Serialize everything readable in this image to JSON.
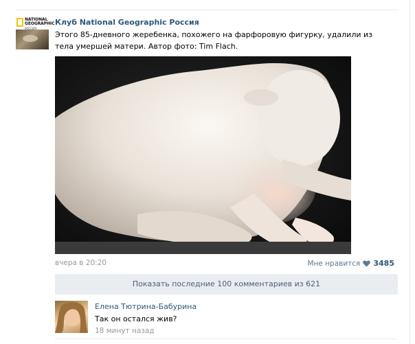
{
  "post": {
    "author": "Клуб National Geographic Россия",
    "text": "Этого 85-дневного жеребенка, похожего на фарфоровую фигурку, удалили из тела умершей матери. Автор фото: Tim Flach.",
    "avatar_logo": {
      "line1": "NATIONAL",
      "line2": "GEOGRAPHIC",
      "line3": "РОССИЯ"
    },
    "time": "вчера в 20:20",
    "like_label": "Мне нравится",
    "like_count": "3485",
    "accent_color": "#2b587a"
  },
  "comments_bar": {
    "label": "Показать последние 100 комментариев из 621"
  },
  "comments": [
    {
      "author": "Елена Тютрина-Бабурина",
      "text": "Так он остался жив?",
      "time": "18 минут назад"
    }
  ]
}
